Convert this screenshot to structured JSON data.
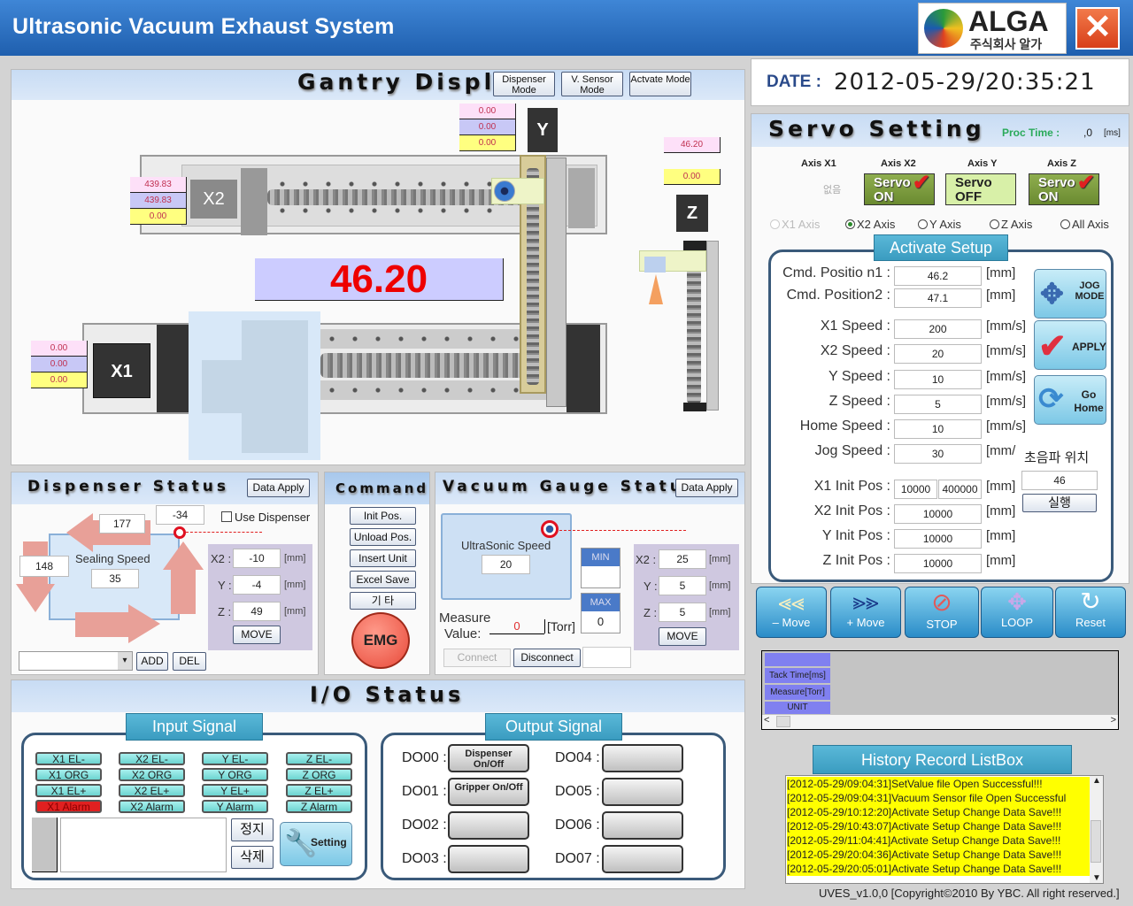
{
  "window": {
    "title": "Ultrasonic Vacuum Exhaust System",
    "logo_text": "ALGA",
    "logo_sub": "주식회사 알가",
    "close_icon": "close-icon",
    "accent": "#1f5fae"
  },
  "gantry": {
    "title": "Gantry Display",
    "mode_buttons": [
      "Dispenser Mode",
      "V. Sensor Mode",
      "Actvate Mode"
    ],
    "y_tags": [
      "0.00",
      "0.00",
      "0.00"
    ],
    "x2_tags": [
      "439.83",
      "439.83",
      "0.00"
    ],
    "x1_tags": [
      "0.00",
      "0.00",
      "0.00"
    ],
    "z_tags": [
      "46.20",
      "0.00"
    ],
    "y_label": "Y",
    "x2_label": "X2",
    "x1_label": "X1",
    "z_label": "Z",
    "big_value": "46.20"
  },
  "date": {
    "label": "DATE :",
    "value": "2012-05-29/20:35:21"
  },
  "servo": {
    "title": "Servo Setting",
    "proc_label": "Proc Time :",
    "proc_value": ",0",
    "proc_unit": "[ms]",
    "axes": [
      {
        "name": "Axis X1",
        "state": "없음"
      },
      {
        "name": "Axis X2",
        "state": "Servo ON"
      },
      {
        "name": "Axis Y",
        "state": "Servo OFF"
      },
      {
        "name": "Axis Z",
        "state": "Servo ON"
      }
    ],
    "radios": [
      "X1 Axis",
      "X2 Axis",
      "Y Axis",
      "Z Axis",
      "All Axis"
    ],
    "selected_radio": "X2 Axis",
    "activate_title": "Activate Setup",
    "rows": [
      {
        "label": "Cmd. Positio n1 :",
        "value": "46.2",
        "unit": "[mm]"
      },
      {
        "label": "Cmd. Position2 :",
        "value": "47.1",
        "unit": "[mm]"
      },
      {
        "label": "X1 Speed :",
        "value": "200",
        "unit": "[mm/s]"
      },
      {
        "label": "X2 Speed :",
        "value": "20",
        "unit": "[mm/s]"
      },
      {
        "label": "Y Speed :",
        "value": "10",
        "unit": "[mm/s]"
      },
      {
        "label": "Z Speed :",
        "value": "5",
        "unit": "[mm/s]"
      },
      {
        "label": "Home Speed :",
        "value": "10",
        "unit": "[mm/s]"
      },
      {
        "label": "Jog Speed :",
        "value": "30",
        "unit": "[mm/"
      },
      {
        "label": "X1 Init Pos :",
        "value": "10000",
        "value2": "400000",
        "unit": "[mm]"
      },
      {
        "label": "X2 Init Pos :",
        "value": "10000",
        "unit": "[mm]"
      },
      {
        "label": "Y Init Pos :",
        "value": "10000",
        "unit": "[mm]"
      },
      {
        "label": "Z Init Pos :",
        "value": "10000",
        "unit": "[mm]"
      }
    ],
    "jog_label": "JOG MODE",
    "apply_label": "APPLY",
    "home_label": "Go Home",
    "ultra_pos_label": "초음파 위치",
    "ultra_pos_value": "46",
    "run_label": "실행"
  },
  "motion": [
    "– Move",
    "+ Move",
    "STOP",
    "LOOP",
    "Reset"
  ],
  "grid": {
    "rows": [
      "",
      "Tack Time[ms]",
      "Measure[Torr]",
      "UNIT"
    ]
  },
  "history": {
    "title": "History Record ListBox",
    "items": [
      "[2012-05-29/09:04:31]SetValue file Open Successful!!!",
      "[2012-05-29/09:04:31]Vacuum Sensor file Open Successful",
      "[2012-05-29/10:12:20]Activate Setup Change Data Save!!!",
      "[2012-05-29/10:43:07]Activate Setup Change Data Save!!!",
      "[2012-05-29/11:04:41]Activate Setup Change Data Save!!!",
      "[2012-05-29/20:04:36]Activate Setup Change Data Save!!!",
      "[2012-05-29/20:05:01]Activate Setup Change Data Save!!!"
    ]
  },
  "copyright": "UVES_v1.0,0 [Copyright©2010 By YBC. All right reserved.]",
  "dispenser": {
    "title": "Dispenser Status",
    "apply": "Data Apply",
    "top": "177",
    "corner": "-34",
    "left": "148",
    "use_label": "Use Dispenser",
    "speed_label": "Sealing Speed",
    "speed": "35",
    "x2": "-10",
    "y": "-4",
    "z": "49",
    "unit": "[mm]",
    "move": "MOVE",
    "add": "ADD",
    "del": "DEL",
    "axis_labels": [
      "X2 :",
      "Y :",
      "Z :"
    ]
  },
  "command": {
    "title": "Command",
    "buttons": [
      "Init Pos.",
      "Unload Pos.",
      "Insert Unit",
      "Excel Save",
      "기 타"
    ],
    "emg": "EMG"
  },
  "vacuum": {
    "title": "Vacuum Gauge Status",
    "apply": "Data Apply",
    "speed_label": "UltraSonic Speed",
    "speed": "20",
    "min": "MIN",
    "min_value": "",
    "max": "MAX",
    "max_value": "0",
    "measure_label1": "Measure",
    "measure_label2": "Value:",
    "measure": "0",
    "torr": "[Torr]",
    "x2": "25",
    "y": "5",
    "z": "5",
    "unit": "[mm]",
    "move": "MOVE",
    "connect": "Connect",
    "disconnect": "Disconnect",
    "axis_labels": [
      "X2 :",
      "Y :",
      "Z :"
    ]
  },
  "io": {
    "title": "I/O Status",
    "input_title": "Input Signal",
    "output_title": "Output Signal",
    "inputs": [
      [
        "X1 EL-",
        "X1 ORG",
        "X1  EL+",
        "X1 Alarm"
      ],
      [
        "X2 EL-",
        "X2 ORG",
        "X2  EL+",
        "X2 Alarm"
      ],
      [
        "Y EL-",
        "Y ORG",
        "Y  EL+",
        "Y Alarm"
      ],
      [
        "Z EL-",
        "Z ORG",
        "Z EL+",
        "Z Alarm"
      ]
    ],
    "alarm_color": "#e02020",
    "stop": "정지",
    "delete": "삭제",
    "setting": "Setting",
    "outputs": [
      {
        "label": "DO00 :",
        "btn": "Dispenser On/Off"
      },
      {
        "label": "DO01 :",
        "btn": "Gripper On/Off"
      },
      {
        "label": "DO02 :",
        "btn": ""
      },
      {
        "label": "DO03 :",
        "btn": ""
      },
      {
        "label": "DO04 :",
        "btn": ""
      },
      {
        "label": "DO05 :",
        "btn": ""
      },
      {
        "label": "DO06 :",
        "btn": ""
      },
      {
        "label": "DO07 :",
        "btn": ""
      }
    ]
  }
}
